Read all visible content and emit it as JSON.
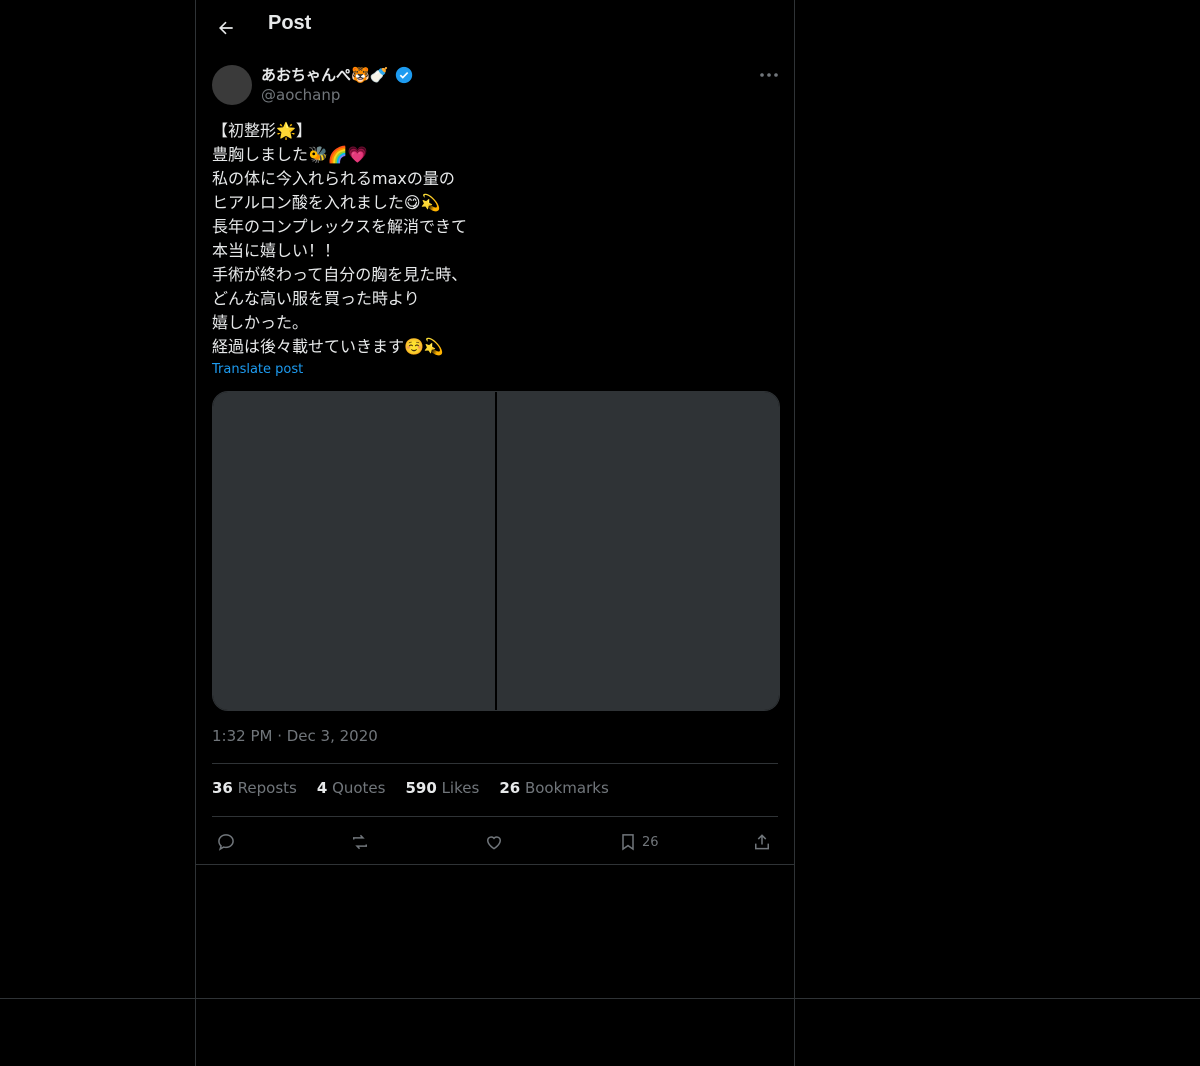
{
  "header": {
    "title": "Post"
  },
  "post": {
    "author_name": "あおちゃんぺ🐯🍼",
    "handle": "@aochanp",
    "text": "【初整形🌟】\n豊胸しました🐝🌈💗\n私の体に今入れられるmaxの量の\nヒアルロン酸を入れました😋💫\n長年のコンプレックスを解消できて\n本当に嬉しい！！\n手術が終わって自分の胸を見た時、\nどんな高い服を買った時より\n嬉しかった。\n経過は後々載せていきます☺️💫",
    "translate_label": "Translate post",
    "timestamp": "1:32 PM · Dec 3, 2020"
  },
  "stats": {
    "reposts_count": "36",
    "reposts_label": "Reposts",
    "quotes_count": "4",
    "quotes_label": "Quotes",
    "likes_count": "590",
    "likes_label": "Likes",
    "bookmarks_count": "26",
    "bookmarks_label": "Bookmarks"
  },
  "actions": {
    "bookmark_count": "26"
  },
  "colors": {
    "background": "#000000",
    "text": "#e7e9ea",
    "muted": "#71767b",
    "accent": "#1d9bf0",
    "border": "#2f3336"
  },
  "icons": [
    "back-arrow-icon",
    "verified-badge-icon",
    "more-icon",
    "reply-icon",
    "repost-icon",
    "like-icon",
    "bookmark-icon",
    "share-icon"
  ]
}
